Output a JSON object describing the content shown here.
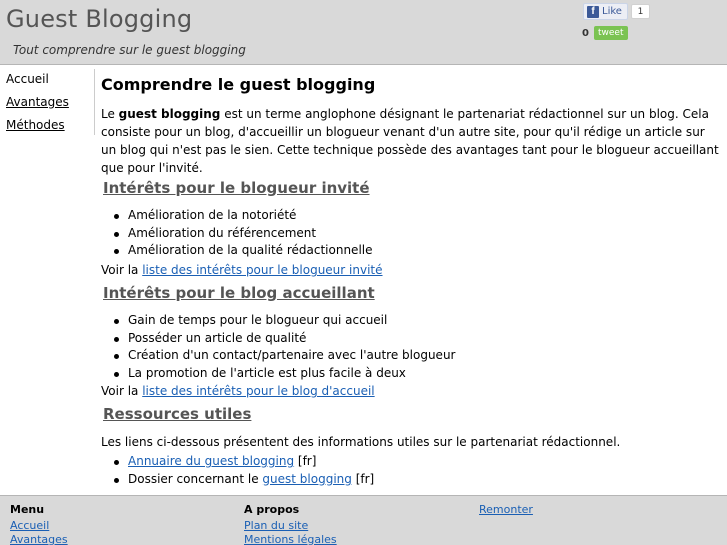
{
  "header": {
    "title": "Guest Blogging",
    "tagline": "Tout comprendre sur le guest blogging",
    "fb_like_label": "Like",
    "fb_like_count": "1",
    "tweet_count": "0",
    "tweet_label": "tweet"
  },
  "sidebar": {
    "items": [
      {
        "label": "Accueil"
      },
      {
        "label": "Avantages"
      },
      {
        "label": "Méthodes"
      }
    ]
  },
  "main": {
    "title": "Comprendre le guest blogging",
    "intro_prefix": "Le ",
    "intro_bold": "guest blogging",
    "intro_rest": " est un terme anglophone désignant le partenariat rédactionnel sur un blog. Cela consiste pour un blog, d'accueillir un blogueur venant d'un autre site, pour qu'il rédige un article sur un blog qui n'est pas le sien. Cette technique possède des avantages tant pour le blogueur accueillant que pour l'invité.",
    "sections": [
      {
        "title": "Intérêts pour le blogueur invité",
        "bullets": [
          "Amélioration de la notoriété",
          "Amélioration du référencement",
          "Amélioration de la qualité rédactionnelle"
        ],
        "see_prefix": "Voir la ",
        "see_link": "liste des intérêts pour le blogueur invité"
      },
      {
        "title": "Intérêts pour le blog accueillant",
        "bullets": [
          "Gain de temps pour le blogueur qui accueil",
          "Posséder un article de qualité",
          "Création d'un contact/partenaire avec l'autre blogueur",
          "La promotion de l'article est plus facile à deux"
        ],
        "see_prefix": "Voir la ",
        "see_link": "liste des intérêts pour le blog d'accueil"
      }
    ],
    "resources": {
      "title": "Ressources utiles",
      "text": "Les liens ci-dessous présentent des informations utiles sur le partenariat rédactionnel.",
      "item1_link": "Annuaire du guest blogging",
      "item1_suffix": " [fr]",
      "item2_prefix": "Dossier concernant le ",
      "item2_link": "guest blogging",
      "item2_suffix": " [fr]"
    }
  },
  "footer": {
    "menu_heading": "Menu",
    "menu_links": [
      "Accueil",
      "Avantages"
    ],
    "about_heading": "A propos",
    "about_links": [
      "Plan du site",
      "Mentions légales"
    ],
    "back_to_top": "Remonter"
  }
}
